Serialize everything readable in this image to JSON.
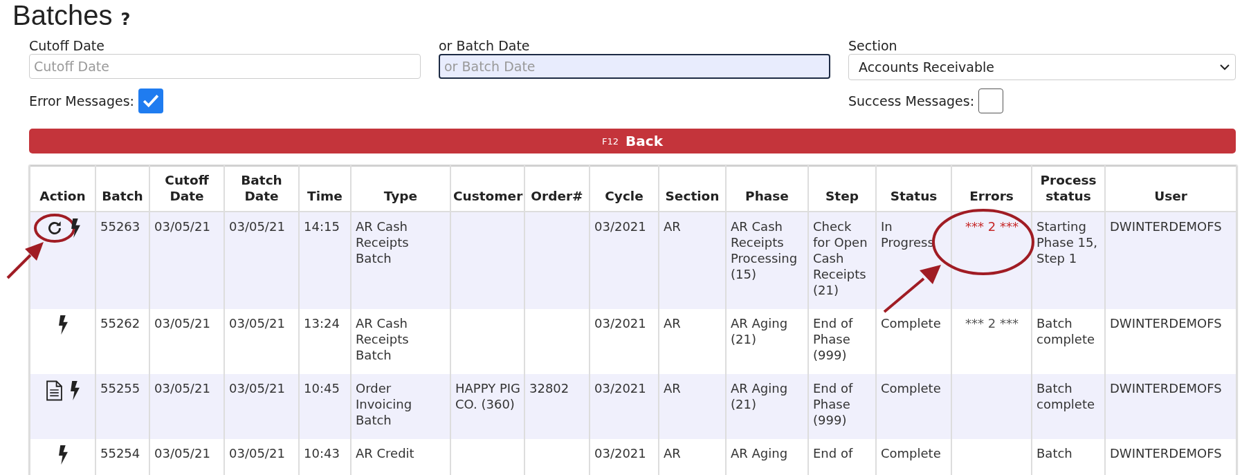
{
  "page": {
    "title": "Batches",
    "help": "?"
  },
  "filters": {
    "cutoff_date": {
      "label": "Cutoff Date",
      "placeholder": "Cutoff Date",
      "focused": false
    },
    "batch_date": {
      "label": "or Batch Date",
      "placeholder": "or Batch Date",
      "focused": true
    },
    "section": {
      "label": "Section",
      "value": "Accounts Receivable"
    },
    "error_messages": {
      "label": "Error Messages:",
      "checked": true
    },
    "success_messages": {
      "label": "Success Messages:",
      "checked": false
    }
  },
  "back_button": {
    "shortcut": "F12",
    "label": "Back"
  },
  "table": {
    "columns": [
      "Action",
      "Batch",
      "Cutoff Date",
      "Batch Date",
      "Time",
      "Type",
      "Customer",
      "Order#",
      "Cycle",
      "Section",
      "Phase",
      "Step",
      "Status",
      "Errors",
      "Process status",
      "User"
    ],
    "rows": [
      {
        "actions": [
          {
            "kind": "refresh",
            "circled": true
          },
          {
            "kind": "lightning",
            "circled": false
          }
        ],
        "batch": "55263",
        "cutoff_date": "03/05/21",
        "batch_date": "03/05/21",
        "time": "14:15",
        "type": "AR Cash Receipts Batch",
        "customer": "",
        "order": "",
        "cycle": "03/2021",
        "section": "AR",
        "phase": "AR Cash Receipts Processing (15)",
        "step": "Check for Open Cash Receipts (21)",
        "status": "In Progress",
        "errors": {
          "text": "*** 2 ***",
          "color": "#c62828",
          "circled": true
        },
        "process_status": "Starting Phase 15, Step 1",
        "user": "DWINTERDEMOFS"
      },
      {
        "actions": [
          {
            "kind": "lightning",
            "circled": false
          }
        ],
        "batch": "55262",
        "cutoff_date": "03/05/21",
        "batch_date": "03/05/21",
        "time": "13:24",
        "type": "AR Cash Receipts Batch",
        "customer": "",
        "order": "",
        "cycle": "03/2021",
        "section": "AR",
        "phase": "AR Aging (21)",
        "step": "End of Phase (999)",
        "status": "Complete",
        "errors": {
          "text": "*** 2 ***",
          "color": "#555555",
          "circled": false
        },
        "process_status": "Batch complete",
        "user": "DWINTERDEMOFS"
      },
      {
        "actions": [
          {
            "kind": "document",
            "circled": false
          },
          {
            "kind": "lightning",
            "circled": false
          }
        ],
        "batch": "55255",
        "cutoff_date": "03/05/21",
        "batch_date": "03/05/21",
        "time": "10:45",
        "type": "Order Invoicing Batch",
        "customer": "HAPPY PIG CO. (360)",
        "order": "32802",
        "cycle": "03/2021",
        "section": "AR",
        "phase": "AR Aging (21)",
        "step": "End of Phase (999)",
        "status": "Complete",
        "process_status": "Batch complete",
        "user": "DWINTERDEMOFS"
      },
      {
        "actions": [
          {
            "kind": "lightning",
            "circled": false
          }
        ],
        "batch": "55254",
        "cutoff_date": "03/05/21",
        "batch_date": "03/05/21",
        "time": "10:43",
        "type": "AR Credit",
        "customer": "",
        "order": "",
        "cycle": "03/2021",
        "section": "AR",
        "phase": "AR Aging",
        "step": "End of",
        "status": "Complete",
        "process_status": "Batch",
        "user": "DWINTERDEMOFS"
      }
    ]
  }
}
